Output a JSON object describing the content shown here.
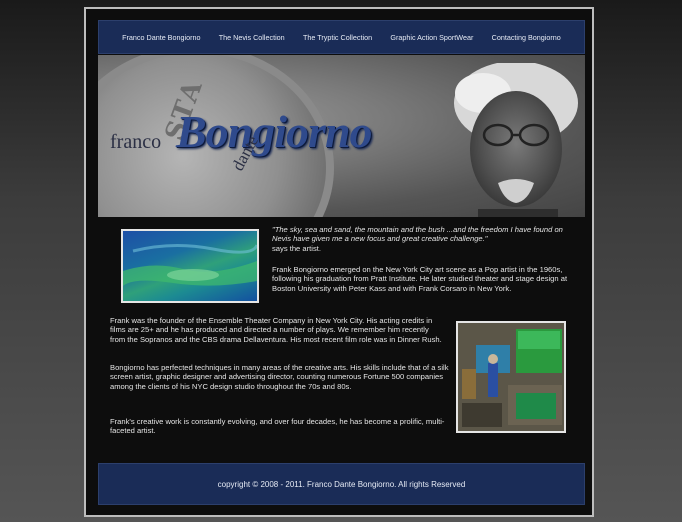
{
  "nav": {
    "items": [
      {
        "label": "Franco Dante Bongiorno"
      },
      {
        "label": "The Nevis Collection"
      },
      {
        "label": "The Tryptic Collection"
      },
      {
        "label": "Graphic Action SportWear"
      },
      {
        "label": "Contacting Bongiorno"
      }
    ]
  },
  "banner": {
    "logo_first": "franco",
    "logo_last": "Bongiorno",
    "logo_middle": "dante"
  },
  "content": {
    "quote": "\"The sky, sea and sand, the mountain and the bush ...and the freedom I have found on Nevis have given me a new focus and great creative challenge.\"",
    "quote_attribution": "says the artist.",
    "para1": "Frank Bongiorno emerged on the New York City art scene as a Pop artist in the 1960s, following his graduation from Pratt Institute. He later studied theater and stage design at Boston University with Peter Kass and with Frank Corsaro in New York.",
    "para2": "Frank was the founder of the Ensemble Theater Company in New York City. His acting credits in films are 25+ and he has produced and directed a number of plays. We remember him recently from the Sopranos and the CBS drama Dellaventura. His most recent film role was in Dinner Rush.",
    "para3": "Bongiorno has perfected techniques in many areas of the creative arts. His skills include that of a silk screen artist, graphic designer and advertising director, counting numerous Fortune 500 companies among the clients of his NYC design studio throughout the 70s and 80s.",
    "para4": "Frank's creative work is constantly evolving, and over four decades, he has become a prolific, multi-faceted artist."
  },
  "footer": {
    "copyright": "copyright © 2008 - 2011. Franco Dante Bongiorno. All rights Reserved"
  }
}
